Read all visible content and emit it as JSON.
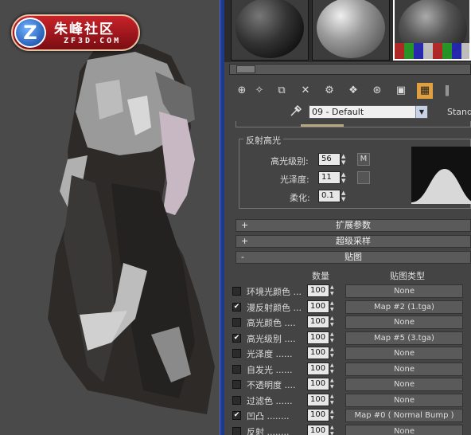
{
  "logo": {
    "badge": "Z",
    "text_cn": "朱峰社区",
    "text_en": "ZF3D.COM"
  },
  "material": {
    "name": "09 - Default",
    "type": "Standa"
  },
  "specular": {
    "title": "反射高光",
    "level_label": "高光级别:",
    "level_value": "56",
    "gloss_label": "光泽度:",
    "gloss_value": "11",
    "soften_label": "柔化:",
    "soften_value": "0.1",
    "m_button": "M"
  },
  "rollouts": {
    "extended": {
      "sign": "+",
      "label": "扩展参数"
    },
    "supersampling": {
      "sign": "+",
      "label": "超级采样"
    },
    "maps": {
      "sign": "-",
      "label": "贴图"
    }
  },
  "maps_table": {
    "col_amount": "数量",
    "col_maptype": "贴图类型",
    "rows": [
      {
        "name": "环境光颜色 ...",
        "checked": false,
        "amount": "100",
        "map": "None"
      },
      {
        "name": "漫反射颜色 ...",
        "checked": true,
        "amount": "100",
        "map": "Map #2 (1.tga)"
      },
      {
        "name": "高光颜色 ....",
        "checked": false,
        "amount": "100",
        "map": "None"
      },
      {
        "name": "高光级别 ....",
        "checked": true,
        "amount": "100",
        "map": "Map #5 (3.tga)"
      },
      {
        "name": "光泽度 ......",
        "checked": false,
        "amount": "100",
        "map": "None"
      },
      {
        "name": "自发光 ......",
        "checked": false,
        "amount": "100",
        "map": "None"
      },
      {
        "name": "不透明度 ....",
        "checked": false,
        "amount": "100",
        "map": "None"
      },
      {
        "name": "过滤色 ......",
        "checked": false,
        "amount": "100",
        "map": "None"
      },
      {
        "name": "凹凸 ........",
        "checked": true,
        "amount": "100",
        "map": "Map #0 ( Normal Bump )"
      },
      {
        "name": "反射 ........",
        "checked": false,
        "amount": "100",
        "map": "None"
      }
    ]
  },
  "colors": {
    "panel_bg": "#444444",
    "viewport_bg": "#4a4a4a",
    "divider_blue": "#1d3a8c",
    "selected_tool": "#e0a040"
  },
  "check_mark": "✔",
  "arrow_up": "▲",
  "arrow_down": "▼",
  "dropdown_arrow": "▼",
  "toolbar_icons": [
    "⊕",
    "✧",
    "⧉",
    "✕",
    "⚙",
    "❖",
    "⊛",
    "▣",
    "▦",
    "‖"
  ]
}
